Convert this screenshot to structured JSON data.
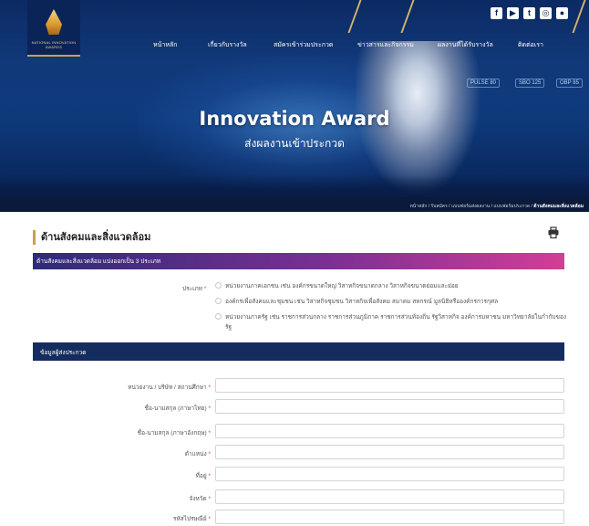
{
  "logo": {
    "text": "NATIONAL INNOVATION AWARDS"
  },
  "social": [
    "f",
    "▶",
    "t",
    "◎",
    "●"
  ],
  "nav": {
    "items": [
      {
        "label": "หน้าหลัก"
      },
      {
        "label": "เกี่ยวกับรางวัล"
      },
      {
        "label": "สมัครเข้าร่วมประกวด"
      },
      {
        "label": "ข่าวสารและกิจกรรม"
      },
      {
        "label": "ผลงานที่ได้รับรางวัล"
      },
      {
        "label": "ติดต่อเรา"
      }
    ]
  },
  "hero": {
    "title": "Innovation Award",
    "subtitle": "ส่งผลงานเข้าประกวด",
    "hud": [
      "PULSE 80",
      "SBO 125",
      "OBP 85"
    ]
  },
  "breadcrumb": {
    "items": [
      "หน้าหลัก",
      "รับสมัคร",
      "แบบฟอร์มส่งผลงาน",
      "แบบฟอร์มประกวด"
    ],
    "current": "ด้านสังคมและสิ่งแวดล้อม"
  },
  "page": {
    "title": "ด้านสังคมและสิ่งแวดล้อม",
    "print_icon": "printer-icon"
  },
  "category_bar": {
    "label": "ด้านสังคมและสิ่งแวดล้อม แบ่งออกเป็น 3 ประเภท"
  },
  "category": {
    "label": "ประเภท",
    "required": "*",
    "options": [
      "หน่วยงานภาคเอกชน เช่น องค์กรขนาดใหญ่ วิสาหกิจขนาดกลาง วิสาหกิจขนาดย่อมและย่อย",
      "องค์กรเพื่อสังคมและชุมชน เช่น วิสาหกิจชุมชน วิสาหกิจเพื่อสังคม สมาคม สหกรณ์ มูลนิธิหรือองค์กรการกุศล",
      "หน่วยงานภาครัฐ เช่น ราชการส่วนกลาง ราชการส่วนภูมิภาค ราชการส่วนท้องถิ่น รัฐวิสาหกิจ องค์การมหาชน มหาวิทยาลัยในกำกับของรัฐ"
    ]
  },
  "applicant_bar": {
    "label": "ข้อมูลผู้ส่งประกวด"
  },
  "fields": [
    {
      "label": "หน่วยงาน / บริษัท / สถานศึกษา",
      "required": "*",
      "value": ""
    },
    {
      "label": "ชื่อ-นามสกุล (ภาษาไทย)",
      "required": "*",
      "value": ""
    },
    {
      "label": "ชื่อ-นามสกุล (ภาษาอังกฤษ)",
      "required": "*",
      "value": ""
    },
    {
      "label": "ตำแหน่ง",
      "required": "*",
      "value": ""
    },
    {
      "label": "ที่อยู่",
      "required": "*",
      "value": ""
    },
    {
      "label": "จังหวัด",
      "required": "*",
      "value": ""
    },
    {
      "label": "รหัสไปรษณีย์",
      "required": "*",
      "value": ""
    }
  ]
}
